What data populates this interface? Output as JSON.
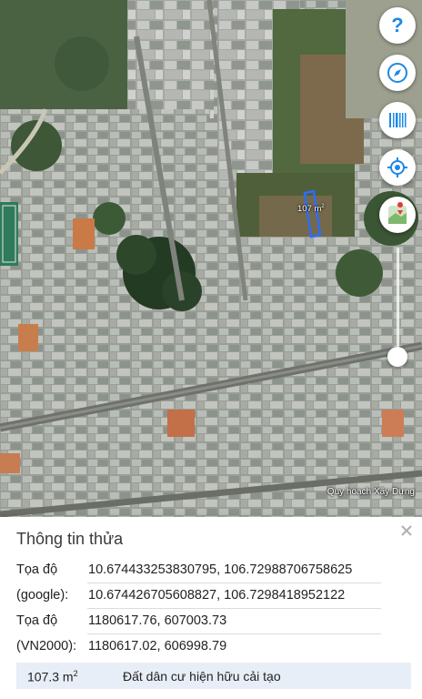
{
  "map": {
    "parcel_area_label": "107 m",
    "parcel_area_unit_sup": "2",
    "attribution": "Quy hoạch Xây Dựng",
    "colors": {
      "parcel_outline": "#2f6cff",
      "help": "#1e88e5",
      "accent": "#1e88e5"
    }
  },
  "controls": [
    {
      "name": "help",
      "icon": "question-icon"
    },
    {
      "name": "compass",
      "icon": "compass-icon"
    },
    {
      "name": "barcode",
      "icon": "barcode-icon"
    },
    {
      "name": "my-location",
      "icon": "crosshair-location-icon"
    },
    {
      "name": "map-layer",
      "icon": "map-layer-icon"
    }
  ],
  "zoom_slider_level": 0.92,
  "panel": {
    "title": "Thông tin thửa",
    "close_icon": "close-icon",
    "rows": [
      {
        "label": "Tọa độ",
        "value": "10.674433253830795, 106.72988706758625"
      },
      {
        "label": "(google):",
        "value": "10.674426705608827, 106.7298418952122"
      },
      {
        "label": "Tọa độ",
        "value": "1180617.76, 607003.73"
      },
      {
        "label": "(VN2000):",
        "value": "1180617.02, 606998.79"
      }
    ],
    "area_value": "107.3 m",
    "area_unit_sup": "2",
    "land_use": "Đất dân cư hiện hữu cải tạo"
  }
}
